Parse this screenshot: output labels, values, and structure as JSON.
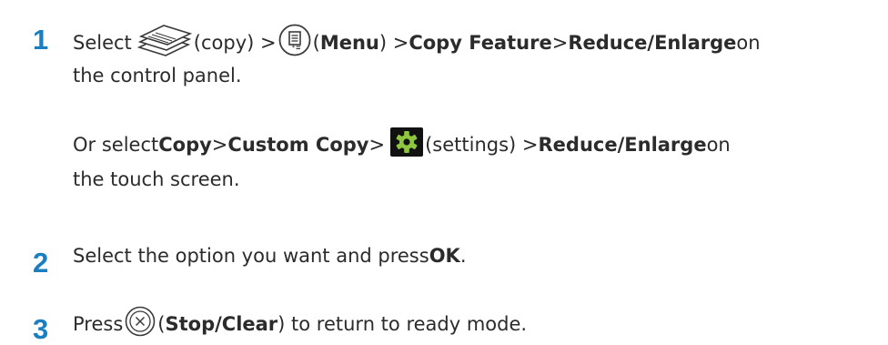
{
  "steps": [
    {
      "number": "1",
      "line1": {
        "t1": "Select ",
        "icon_copy": "copy-icon",
        "t2": "(copy) > ",
        "icon_menu": "menu-icon",
        "t3": "(",
        "b1": "Menu",
        "t4": ") > ",
        "b2": "Copy Feature",
        "t5": " > ",
        "b3": "Reduce/Enlarge",
        "t6": " on"
      },
      "line2": "the control panel.",
      "line3": {
        "t1": "Or select ",
        "b1": "Copy",
        "t2": " > ",
        "b2": "Custom Copy",
        "t3": " > ",
        "icon_settings": "gear-icon",
        "t4": "(settings) > ",
        "b3": "Reduce/Enlarge",
        "t5": " on"
      },
      "line4": "the touch screen."
    },
    {
      "number": "2",
      "line1": {
        "t1": "Select the option you want and press ",
        "b1": "OK",
        "t2": "."
      }
    },
    {
      "number": "3",
      "line1": {
        "t1": "Press ",
        "icon_stop": "stop-clear-icon",
        "t2": "(",
        "b1": "Stop/Clear",
        "t3": ") to return to ready mode."
      }
    }
  ],
  "colors": {
    "step_number": "#1a7ec1",
    "text": "#2b2b2b"
  }
}
